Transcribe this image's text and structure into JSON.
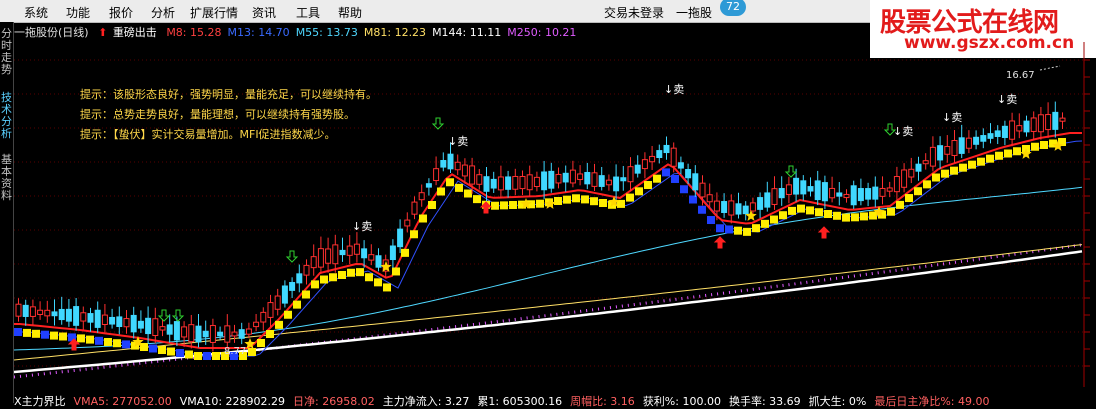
{
  "menu": {
    "items": [
      "系统",
      "功能",
      "报价",
      "分析",
      "扩展行情",
      "资讯",
      "工具",
      "帮助"
    ],
    "trade_status": "交易未登录",
    "stock_short": "一拖股",
    "badge": "72"
  },
  "watermark": {
    "title": "股票公式在线网",
    "url": "www.gszx.com.cn"
  },
  "sidebar": {
    "tabs": [
      "分时走势",
      "技术分析",
      "基本资料"
    ]
  },
  "infobar": {
    "stock_title": "一拖股份(日线)",
    "indicator_label": "重磅出击",
    "ma_values": [
      {
        "label": "M8: 15.28",
        "color": "#ff4040"
      },
      {
        "label": "M13: 14.70",
        "color": "#3a6bff"
      },
      {
        "label": "M55: 13.73",
        "color": "#4fd8ff"
      },
      {
        "label": "M81: 12.23",
        "color": "#ffe066"
      },
      {
        "label": "M144: 11.11",
        "color": "#ffffff"
      },
      {
        "label": "M250: 10.21",
        "color": "#e05cff"
      }
    ]
  },
  "hints": [
    "提示：该股形态良好，强势明显，量能充足，可以继续持有。",
    "提示：总势走势良好，量能理想，可以继续持有强势股。",
    "提示：【蛰伏】实计交易量增加。MFI促进指数减少。"
  ],
  "annotations": {
    "sell_label": "↓卖",
    "high_price": "16.67",
    "low_price": "8.77"
  },
  "bottombar": [
    {
      "text": "X主力界比",
      "color": "#ffffff"
    },
    {
      "text": "VMA5: 277052.00",
      "color": "#ff6060"
    },
    {
      "text": "VMA10: 228902.29",
      "color": "#ffffff"
    },
    {
      "text": "日净: 26958.02",
      "color": "#ff6060"
    },
    {
      "text": "主力净流入: 3.27",
      "color": "#ffffff"
    },
    {
      "text": "累1: 605300.16",
      "color": "#ffffff"
    },
    {
      "text": "周帽比: 3.16",
      "color": "#ff6060"
    },
    {
      "text": "获利%: 100.00",
      "color": "#ffffff"
    },
    {
      "text": "换手率: 33.69",
      "color": "#ffffff"
    },
    {
      "text": "抓大生: 0%",
      "color": "#ffffff"
    },
    {
      "text": "最后日主净比%: 49.00",
      "color": "#ff6060"
    }
  ],
  "colors": {
    "up": "#ff3030",
    "down": "#40d8ff",
    "yellow_band": "#ffee00",
    "blue_band": "#2040ff",
    "ma55": "#4fd8ff",
    "ma81": "#ffe066",
    "ma144": "#ffffff",
    "ma250": "#e05cff",
    "arrow_green": "#30d030",
    "arrow_red": "#ff2020",
    "star": "#ffd800"
  }
}
